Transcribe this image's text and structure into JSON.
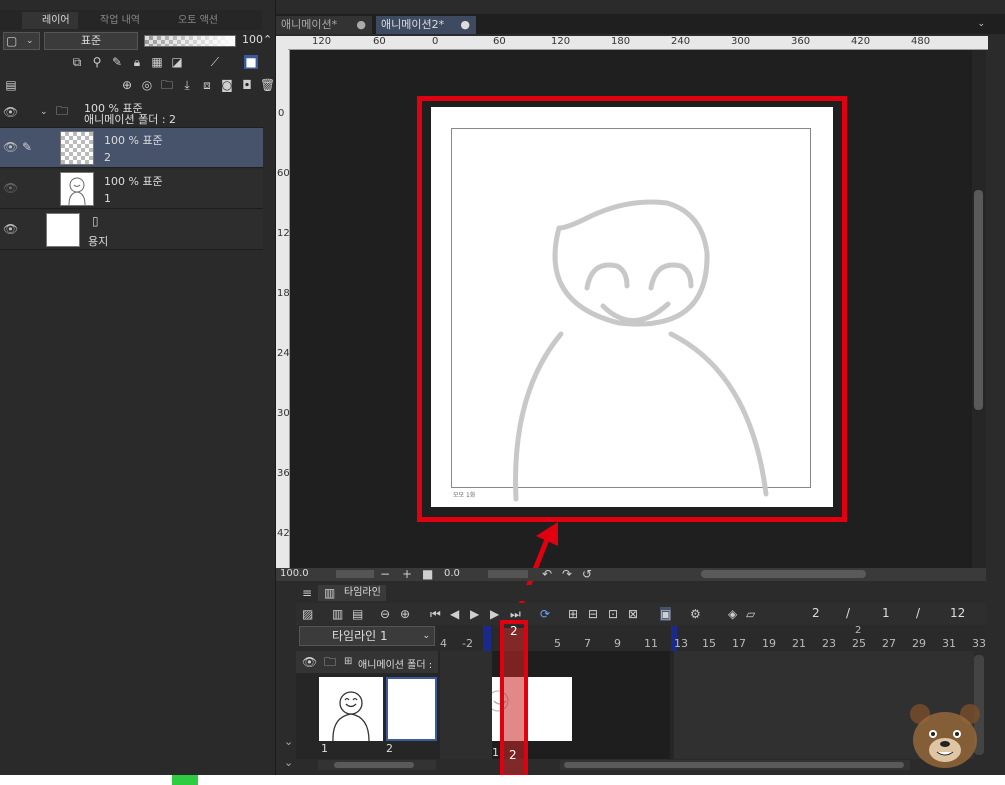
{
  "layer_panel": {
    "tabs": [
      "레이어",
      "작업 내역",
      "오토 액션"
    ],
    "blend_mode": "표준",
    "opacity": "100",
    "layers": [
      {
        "opacity_mode": "100 % 표준",
        "name": "애니메이션 폴더 : 2"
      },
      {
        "opacity_mode": "100 % 표준",
        "name": "2"
      },
      {
        "opacity_mode": "100 % 표준",
        "name": "1"
      },
      {
        "opacity_mode": "",
        "name": "용지"
      }
    ]
  },
  "document_tabs": [
    "애니메이션*",
    "애니메이션2*"
  ],
  "ruler": {
    "h_ticks": [
      "120",
      "60",
      "0",
      "60",
      "120",
      "180",
      "240",
      "300",
      "360",
      "420",
      "480"
    ],
    "v_ticks": [
      "0",
      "60",
      "120",
      "180",
      "240",
      "300",
      "360",
      "420"
    ]
  },
  "canvas": {
    "frame_label": "모모 1화",
    "zoom": "100.0",
    "angle": "0.0"
  },
  "timeline": {
    "tab": "타임라인",
    "name": "타임라인 1",
    "current_frame": "2",
    "frame_info": [
      "2",
      "/",
      "1",
      "/",
      "12"
    ],
    "track_label": "애니메이션 폴더 :",
    "ruler_numbers": [
      "4",
      "-2",
      "2",
      "5",
      "7",
      "9",
      "11",
      "13",
      "15",
      "17",
      "19",
      "21",
      "23",
      "25",
      "27",
      "29",
      "31",
      "33"
    ],
    "second_marker": "2",
    "cels": [
      "1",
      "2"
    ],
    "cel_on_track": "1",
    "playhead_label": "2"
  },
  "colors": {
    "accent": "#e00010",
    "selection": "#46536b"
  }
}
